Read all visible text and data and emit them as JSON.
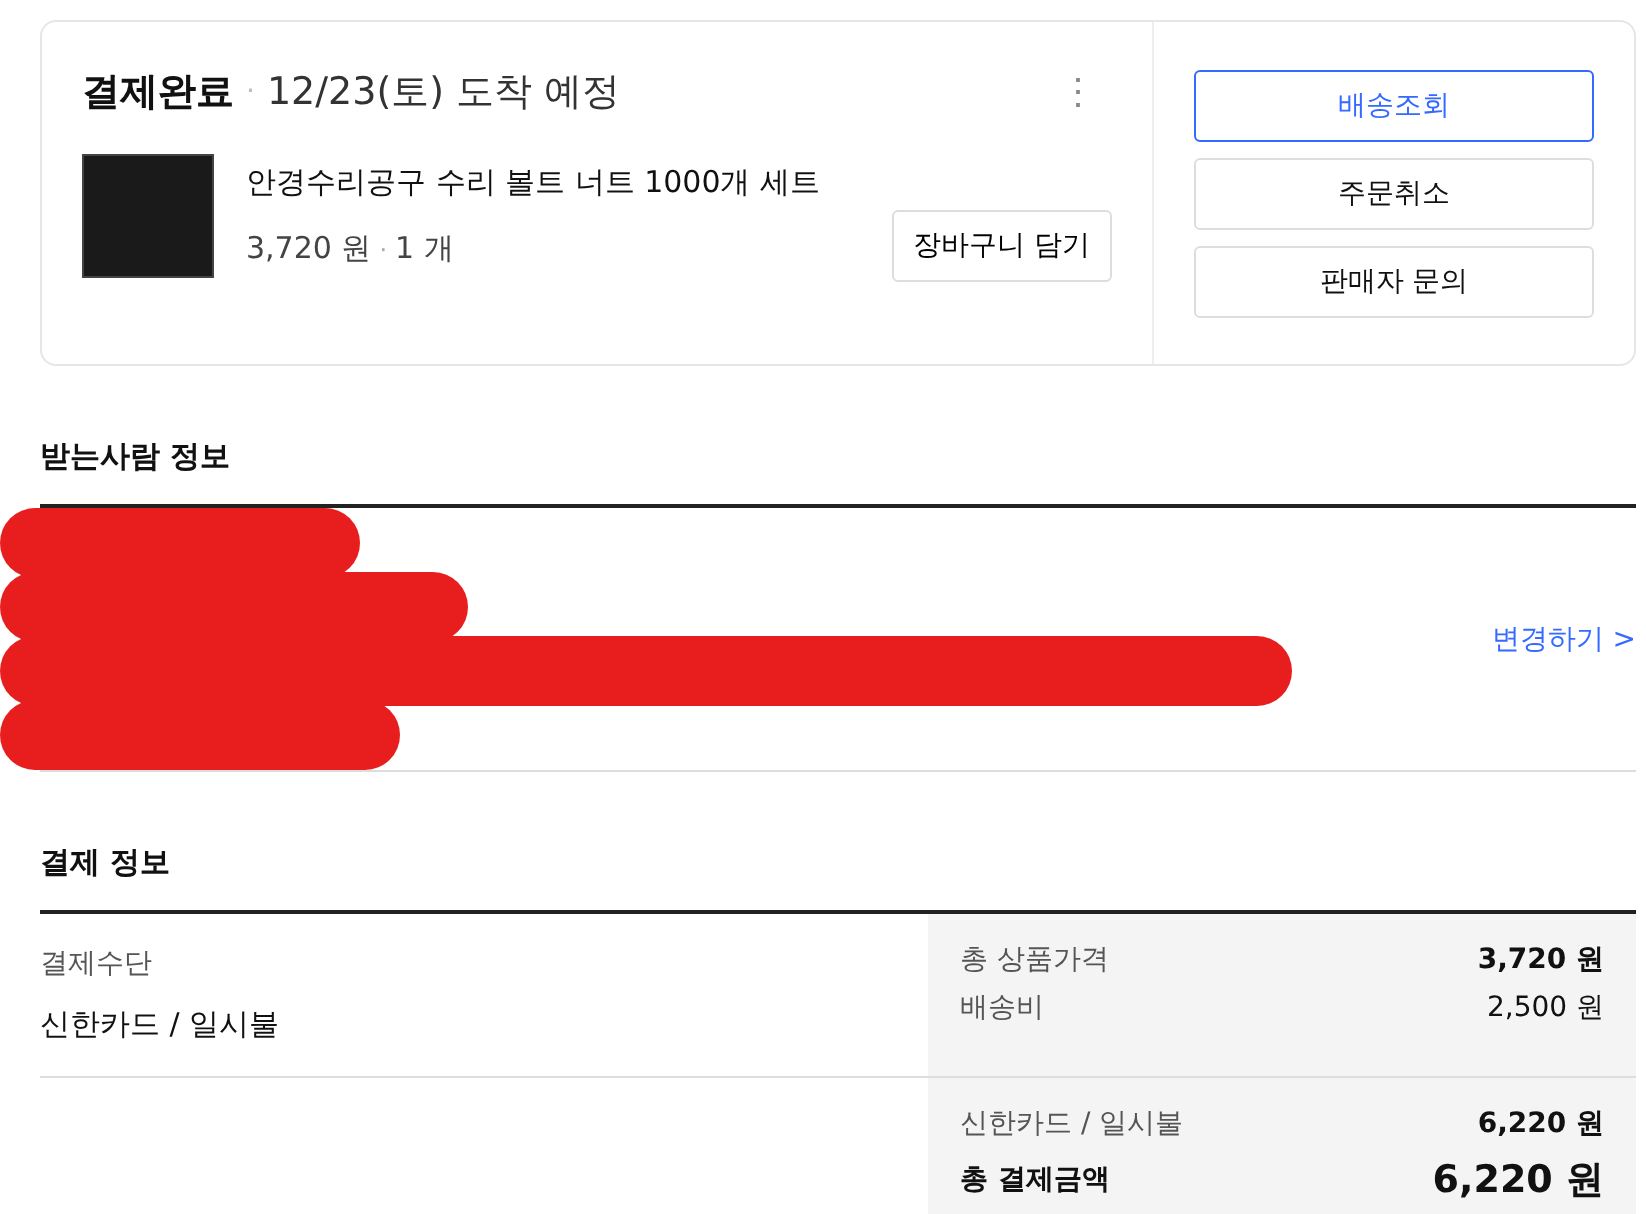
{
  "order": {
    "status": "결제완료",
    "separator": "·",
    "arrival": "12/23(토) 도착 예정",
    "more_menu": "⋮",
    "product": {
      "name": "안경수리공구 수리 볼트 너트 1000개 세트",
      "price": "3,720 원",
      "dot": "·",
      "quantity": "1 개",
      "cart_button": "장바구니 담기"
    },
    "actions": [
      {
        "label": "배송조회",
        "primary": true
      },
      {
        "label": "주문취소",
        "primary": false
      },
      {
        "label": "판매자 문의",
        "primary": false
      }
    ]
  },
  "recipient": {
    "title": "받는사람 정보",
    "redacted": true,
    "change_link": "변경하기 >"
  },
  "payment": {
    "title": "결제 정보",
    "method_label": "결제수단",
    "method": "신한카드 / 일시불",
    "groups": [
      {
        "rows": [
          {
            "label": "총 상품가격",
            "value": "3,720 원",
            "kind": "strong"
          },
          {
            "label": "배송비",
            "value": "2,500 원",
            "kind": "plain"
          }
        ]
      },
      {
        "rows": [
          {
            "label": "신한카드 / 일시불",
            "value": "6,220 원",
            "kind": "strong"
          },
          {
            "label": "총 결제금액",
            "value": "6,220 원",
            "kind": "total"
          }
        ]
      }
    ]
  }
}
